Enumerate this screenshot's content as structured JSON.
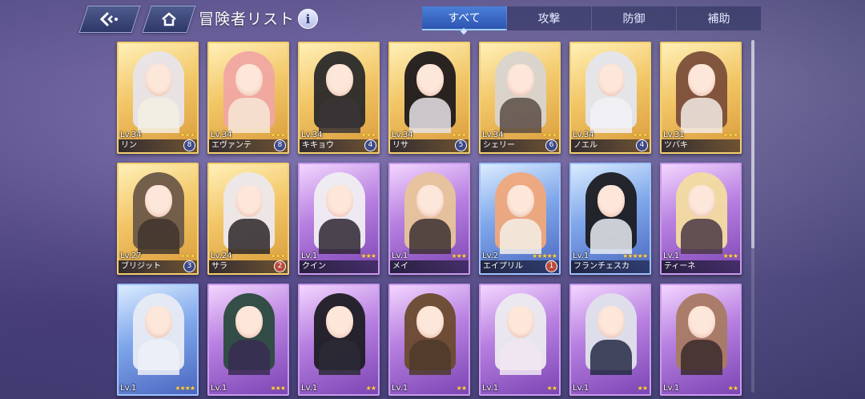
{
  "header": {
    "title": "冒険者リスト",
    "info_label": "i",
    "back_icon": "back-arrow-icon",
    "home_icon": "home-icon"
  },
  "tabs": [
    {
      "label": "すべて",
      "active": true
    },
    {
      "label": "攻撃",
      "active": false
    },
    {
      "label": "防御",
      "active": false
    },
    {
      "label": "補助",
      "active": false
    }
  ],
  "scroll": {
    "position": 0.0
  },
  "colors": {
    "gold_frame": "#f3cf6e",
    "purple_frame": "#c99aee",
    "blue_frame": "#9fc0ff",
    "active_tab": "#3c6ac8"
  },
  "cards": [
    {
      "level": "Lv.34",
      "name": "リン",
      "stars": "★★★",
      "badge": "8",
      "rarity": "gold",
      "hair": "#e8e4ea",
      "outfit": "#f3f0e4"
    },
    {
      "level": "Lv.34",
      "name": "エヴァンテ",
      "stars": "★★★",
      "badge": "8",
      "rarity": "gold",
      "hair": "#f0a6a2",
      "outfit": "#f6e8d6"
    },
    {
      "level": "Lv.34",
      "name": "キキョウ",
      "stars": "★★★",
      "badge": "4",
      "rarity": "gold",
      "hair": "#2a2a2a",
      "outfit": "#3a3436"
    },
    {
      "level": "Lv.34",
      "name": "リサ",
      "stars": "★★★",
      "badge": "5",
      "rarity": "gold",
      "hair": "#1e1a1c",
      "outfit": "#e7e3e8"
    },
    {
      "level": "Lv.34",
      "name": "シェリー",
      "stars": "★★★",
      "badge": "6",
      "rarity": "gold",
      "hair": "#d9d4d0",
      "outfit": "#5a4c44"
    },
    {
      "level": "Lv.34",
      "name": "ノエル",
      "stars": "★★★",
      "badge": "4",
      "rarity": "gold",
      "hair": "#e4e6ee",
      "outfit": "#f2f2f6"
    },
    {
      "level": "Lv.31",
      "name": "ツバキ",
      "stars": "★★★",
      "badge": "",
      "rarity": "gold",
      "hair": "#7b4e3a",
      "outfit": "#f3ece6"
    },
    {
      "level": "Lv.27",
      "name": "ブリジット",
      "stars": "★★★",
      "badge": "3",
      "rarity": "gold",
      "hair": "#6b5848",
      "outfit": "#3e342e"
    },
    {
      "level": "Lv.24",
      "name": "サラ",
      "stars": "★★★",
      "badge": "2",
      "rarity": "gold",
      "hair": "#ece8ec",
      "outfit": "#2c2628"
    },
    {
      "level": "Lv.1",
      "name": "クイン",
      "stars": "★★★",
      "badge": "",
      "rarity": "purple",
      "hair": "#f0eef2",
      "outfit": "#2e2630"
    },
    {
      "level": "Lv.1",
      "name": "メイ",
      "stars": "★★★",
      "badge": "",
      "rarity": "purple",
      "hair": "#e8c49a",
      "outfit": "#3c3032"
    },
    {
      "level": "Lv.2",
      "name": "エイプリル",
      "stars": "★★★★★",
      "badge": "1",
      "rarity": "blue",
      "hair": "#f0a87a",
      "outfit": "#f4efe8"
    },
    {
      "level": "Lv.1",
      "name": "フランチェスカ",
      "stars": "★★★★★",
      "badge": "",
      "rarity": "blue",
      "hair": "#1c1c22",
      "outfit": "#e9ecf2"
    },
    {
      "level": "Lv.1",
      "name": "ティーネ",
      "stars": "★★★",
      "badge": "",
      "rarity": "purple",
      "hair": "#f3dca0",
      "outfit": "#4a3844"
    },
    {
      "level": "Lv.1",
      "name": "",
      "stars": "★★★★",
      "badge": "",
      "rarity": "blue",
      "hair": "#e8ebf4",
      "outfit": "#eef0f8"
    },
    {
      "level": "Lv.1",
      "name": "",
      "stars": "★★★",
      "badge": "",
      "rarity": "purple",
      "hair": "#2b4a3e",
      "outfit": "#3a2c52"
    },
    {
      "level": "Lv.1",
      "name": "",
      "stars": "★★",
      "badge": "",
      "rarity": "purple",
      "hair": "#1e1c24",
      "outfit": "#2c2a36"
    },
    {
      "level": "Lv.1",
      "name": "",
      "stars": "★★",
      "badge": "",
      "rarity": "purple",
      "hair": "#6a4a2e",
      "outfit": "#4e3a2a"
    },
    {
      "level": "Lv.1",
      "name": "",
      "stars": "★★",
      "badge": "",
      "rarity": "purple",
      "hair": "#ecebef",
      "outfit": "#f0e6f2"
    },
    {
      "level": "Lv.1",
      "name": "",
      "stars": "★★",
      "badge": "",
      "rarity": "purple",
      "hair": "#dfe2ea",
      "outfit": "#252a44"
    },
    {
      "level": "Lv.1",
      "name": "",
      "stars": "★★",
      "badge": "",
      "rarity": "purple",
      "hair": "#a87a62",
      "outfit": "#3a2a2c"
    }
  ]
}
